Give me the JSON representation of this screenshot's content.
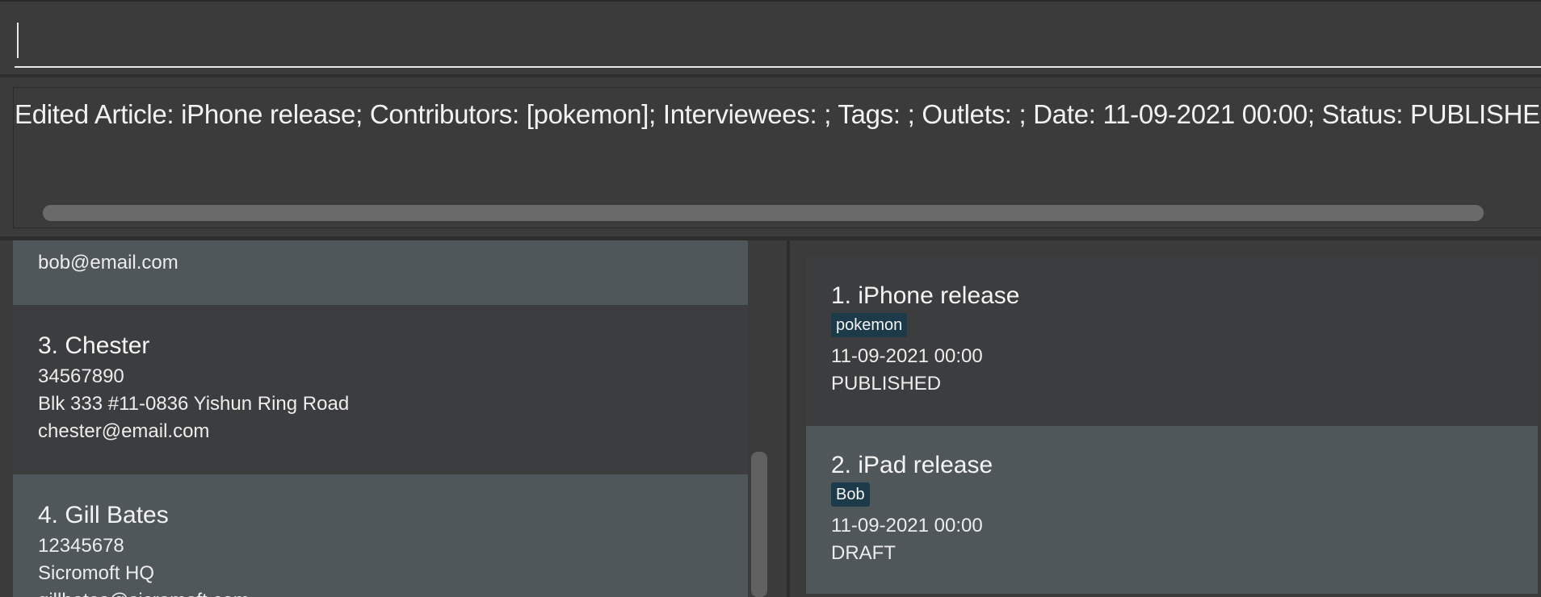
{
  "command": {
    "value": ""
  },
  "result": {
    "text": "Edited Article: iPhone release; Contributors: [pokemon]; Interviewees: ; Tags: ; Outlets: ; Date: 11-09-2021 00:00; Status: PUBLISHED"
  },
  "persons": [
    {
      "index_name": "",
      "email": "bob@email.com"
    },
    {
      "index_name": "3.  Chester",
      "phone": "34567890",
      "address": "Blk 333 #11-0836 Yishun Ring Road",
      "email": "chester@email.com"
    },
    {
      "index_name": "4.  Gill Bates",
      "phone": "12345678",
      "address": "Sicromoft HQ",
      "email": "gillbates@sicromoft.com"
    }
  ],
  "articles": [
    {
      "index_title": "1.  iPhone release",
      "tag": "pokemon",
      "date": "11-09-2021 00:00",
      "status": "PUBLISHED"
    },
    {
      "index_title": "2.  iPad release",
      "tag": "Bob",
      "date": "11-09-2021 00:00",
      "status": "DRAFT"
    }
  ],
  "colors": {
    "background": "#3b3b3b",
    "card_light": "#50575b",
    "card_dark": "#3c3d3f",
    "tag": "#1d3a4a",
    "text": "#ececec"
  }
}
